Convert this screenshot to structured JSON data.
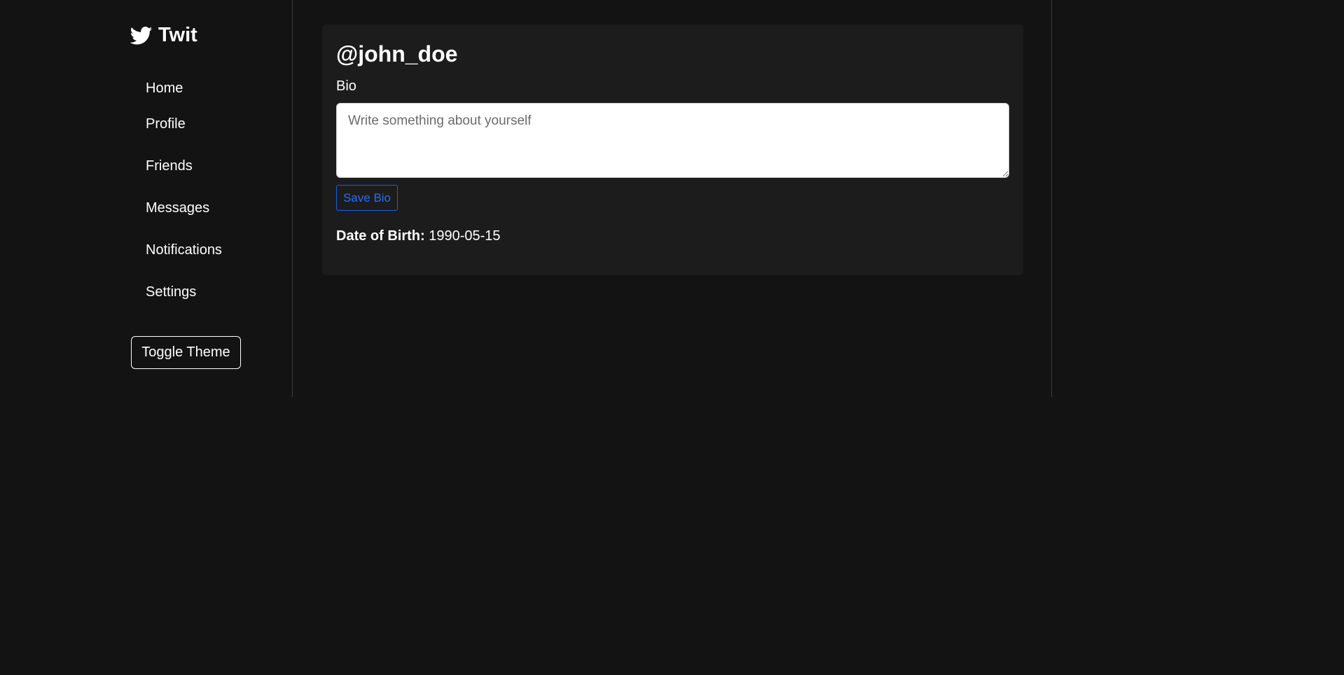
{
  "app": {
    "name": "Twit",
    "logo_icon": "twitter-bird-icon"
  },
  "sidebar": {
    "items": [
      {
        "label": "Home"
      },
      {
        "label": "Profile"
      },
      {
        "label": "Friends"
      },
      {
        "label": "Messages"
      },
      {
        "label": "Notifications"
      },
      {
        "label": "Settings"
      }
    ],
    "toggle_theme_label": "Toggle Theme"
  },
  "profile": {
    "username": "@john_doe",
    "bio_label": "Bio",
    "bio_value": "",
    "bio_placeholder": "Write something about yourself",
    "save_bio_label": "Save Bio",
    "dob_label": "Date of Birth:",
    "dob_value": "1990-05-15"
  },
  "colors": {
    "background": "#131313",
    "card": "#1c1c1c",
    "accent": "#2a6df4",
    "text": "#ffffff"
  }
}
